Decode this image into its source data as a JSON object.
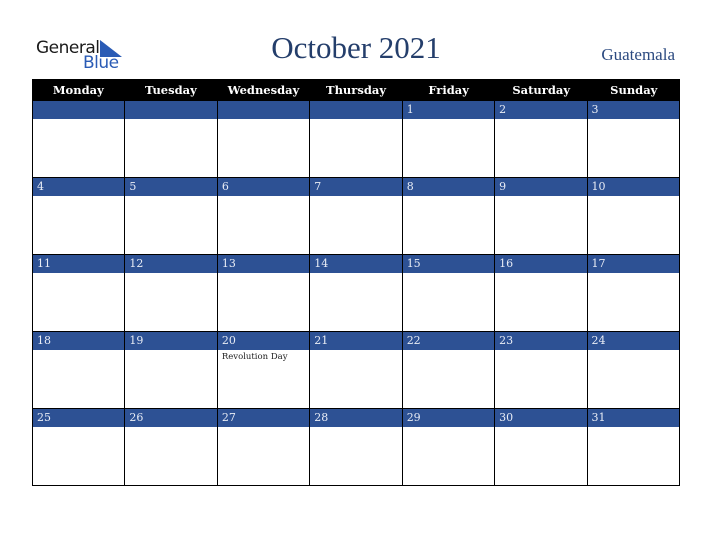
{
  "logo": {
    "word1": "General",
    "word2": "Blue"
  },
  "title": "October 2021",
  "country": "Guatemala",
  "colors": {
    "header_bg": "#000000",
    "date_strip": "#2d5194",
    "title": "#243e6b"
  },
  "weekdays": [
    "Monday",
    "Tuesday",
    "Wednesday",
    "Thursday",
    "Friday",
    "Saturday",
    "Sunday"
  ],
  "weeks": [
    [
      {
        "day": "",
        "note": ""
      },
      {
        "day": "",
        "note": ""
      },
      {
        "day": "",
        "note": ""
      },
      {
        "day": "",
        "note": ""
      },
      {
        "day": "1",
        "note": ""
      },
      {
        "day": "2",
        "note": ""
      },
      {
        "day": "3",
        "note": ""
      }
    ],
    [
      {
        "day": "4",
        "note": ""
      },
      {
        "day": "5",
        "note": ""
      },
      {
        "day": "6",
        "note": ""
      },
      {
        "day": "7",
        "note": ""
      },
      {
        "day": "8",
        "note": ""
      },
      {
        "day": "9",
        "note": ""
      },
      {
        "day": "10",
        "note": ""
      }
    ],
    [
      {
        "day": "11",
        "note": ""
      },
      {
        "day": "12",
        "note": ""
      },
      {
        "day": "13",
        "note": ""
      },
      {
        "day": "14",
        "note": ""
      },
      {
        "day": "15",
        "note": ""
      },
      {
        "day": "16",
        "note": ""
      },
      {
        "day": "17",
        "note": ""
      }
    ],
    [
      {
        "day": "18",
        "note": ""
      },
      {
        "day": "19",
        "note": ""
      },
      {
        "day": "20",
        "note": "Revolution Day"
      },
      {
        "day": "21",
        "note": ""
      },
      {
        "day": "22",
        "note": ""
      },
      {
        "day": "23",
        "note": ""
      },
      {
        "day": "24",
        "note": ""
      }
    ],
    [
      {
        "day": "25",
        "note": ""
      },
      {
        "day": "26",
        "note": ""
      },
      {
        "day": "27",
        "note": ""
      },
      {
        "day": "28",
        "note": ""
      },
      {
        "day": "29",
        "note": ""
      },
      {
        "day": "30",
        "note": ""
      },
      {
        "day": "31",
        "note": ""
      }
    ]
  ]
}
